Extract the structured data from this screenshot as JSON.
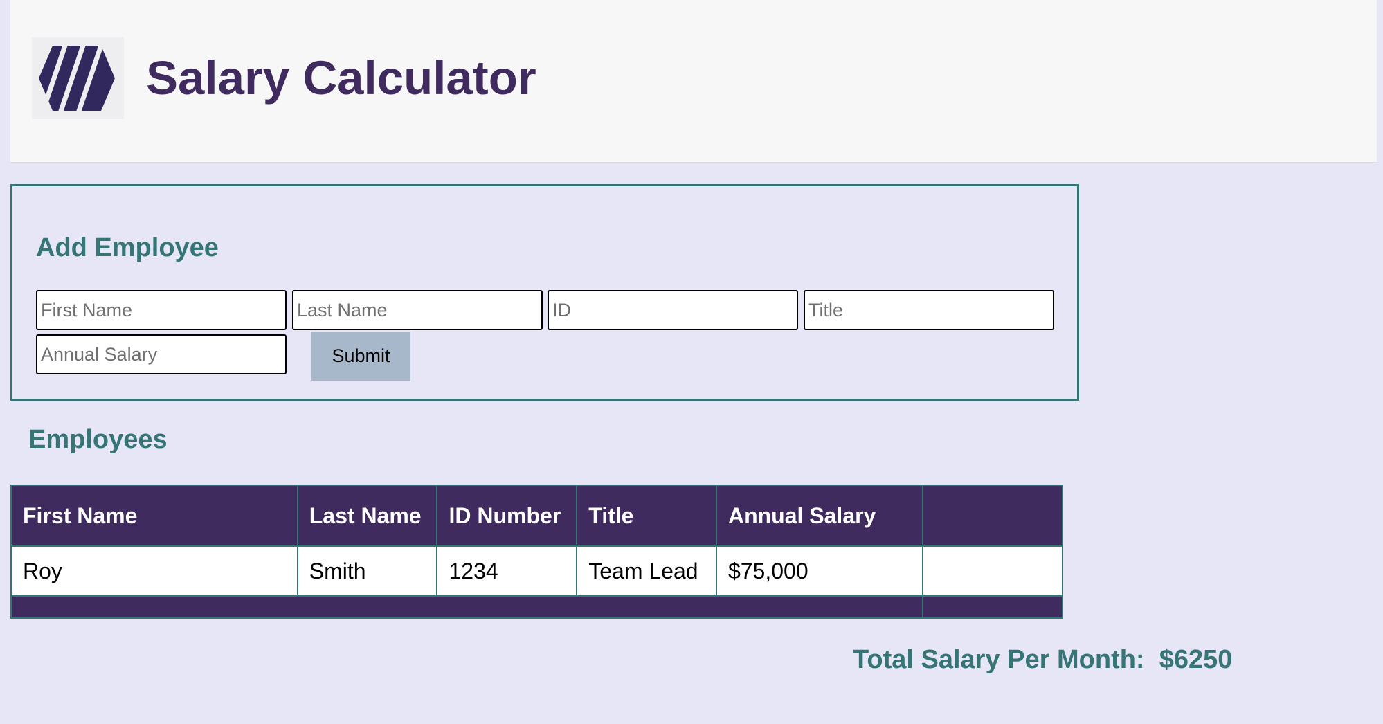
{
  "header": {
    "logo_icon": "hexagon-stripes-logo-icon",
    "title": "Salary Calculator"
  },
  "colors": {
    "brand_purple": "#402b5e",
    "accent_teal": "#367575",
    "page_background": "#e6e6f7",
    "button_background": "#a7b8ca"
  },
  "form": {
    "title": "Add Employee",
    "first_name_placeholder": "First Name",
    "last_name_placeholder": "Last Name",
    "id_placeholder": "ID",
    "title_placeholder": "Title",
    "annual_salary_placeholder": "Annual Salary",
    "submit_label": "Submit"
  },
  "employees": {
    "title": "Employees",
    "columns": [
      "First Name",
      "Last Name",
      "ID Number",
      "Title",
      "Annual Salary",
      ""
    ],
    "rows": [
      [
        "Roy",
        "Smith",
        "1234",
        "Team Lead",
        "$75,000",
        ""
      ]
    ]
  },
  "total": {
    "label": "Total Salary Per Month:",
    "value": "$6250"
  }
}
